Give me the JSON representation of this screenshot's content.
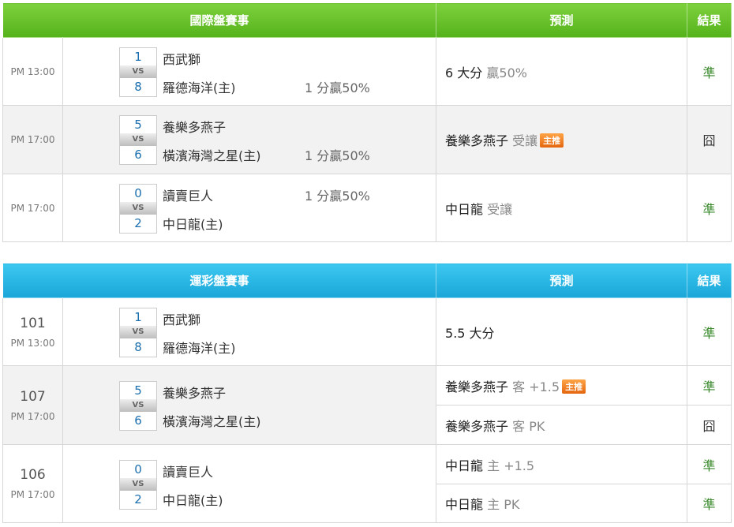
{
  "sections": {
    "intl": {
      "header": {
        "title": "國際盤賽事",
        "prediction": "預測",
        "result": "結果"
      },
      "rows": [
        {
          "time": "PM 13:00",
          "score_a": "1",
          "score_b": "8",
          "team_a": "西武獅",
          "team_b": "羅德海洋(主)",
          "handicap": "1 分贏50%",
          "pred_main": "6 大分",
          "pred_sub": "贏50%",
          "result": "準"
        },
        {
          "time": "PM 17:00",
          "score_a": "5",
          "score_b": "6",
          "team_a": "養樂多燕子",
          "team_b": "橫濱海灣之星(主)",
          "handicap": "1 分贏50%",
          "pred_main": "養樂多燕子",
          "pred_sub": "受讓",
          "badge": "主推",
          "result": "囧"
        },
        {
          "time": "PM 17:00",
          "score_a": "0",
          "score_b": "2",
          "team_a": "讀賣巨人",
          "team_b": "中日龍(主)",
          "handicap": "1 分贏50%",
          "pred_main": "中日龍",
          "pred_sub": "受讓",
          "result": "準"
        }
      ]
    },
    "lottery": {
      "header": {
        "title": "運彩盤賽事",
        "prediction": "預測",
        "result": "結果"
      },
      "rows": [
        {
          "no": "101",
          "time": "PM 13:00",
          "score_a": "1",
          "score_b": "8",
          "team_a": "西武獅",
          "team_b": "羅德海洋(主)",
          "preds": [
            {
              "main": "5.5 大分",
              "sub": "",
              "result": "準"
            }
          ]
        },
        {
          "no": "107",
          "time": "PM 17:00",
          "score_a": "5",
          "score_b": "6",
          "team_a": "養樂多燕子",
          "team_b": "橫濱海灣之星(主)",
          "preds": [
            {
              "main": "養樂多燕子",
              "sub": "客 +1.5",
              "badge": "主推",
              "result": "準"
            },
            {
              "main": "養樂多燕子",
              "sub": "客 PK",
              "result": "囧"
            }
          ]
        },
        {
          "no": "106",
          "time": "PM 17:00",
          "score_a": "0",
          "score_b": "2",
          "team_a": "讀賣巨人",
          "team_b": "中日龍(主)",
          "preds": [
            {
              "main": "中日龍",
              "sub": "主 +1.5",
              "result": "準"
            },
            {
              "main": "中日龍",
              "sub": "主 PK",
              "result": "準"
            }
          ]
        }
      ]
    }
  }
}
